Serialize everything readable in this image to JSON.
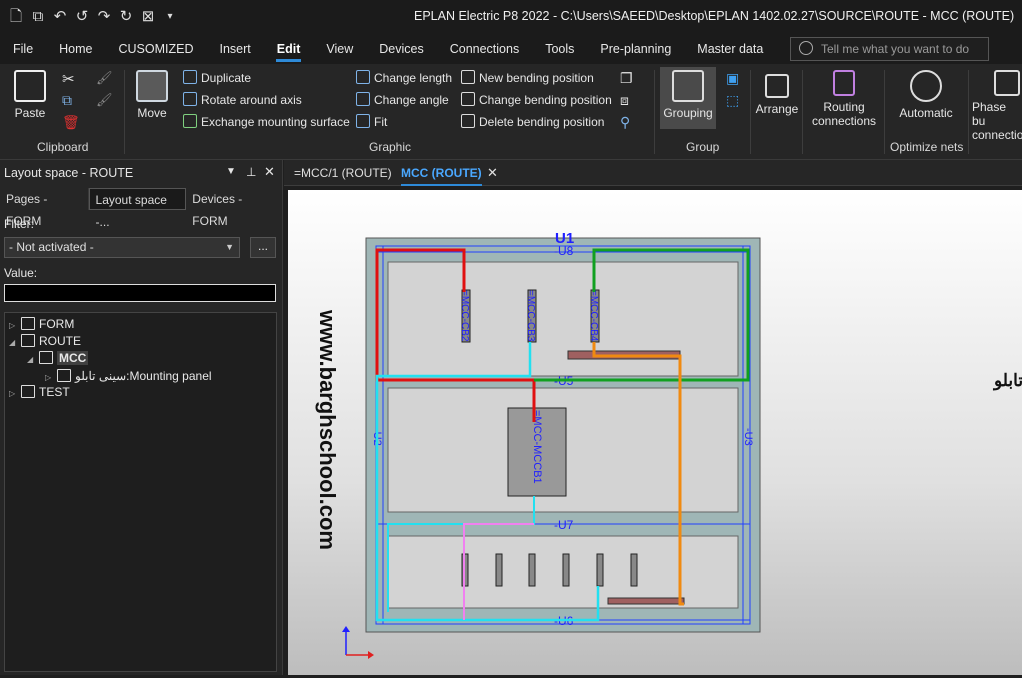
{
  "window": {
    "title": "EPLAN Electric P8 2022 - C:\\Users\\SAEED\\Desktop\\EPLAN 1402.02.27\\SOURCE\\ROUTE - MCC (ROUTE)"
  },
  "menu": {
    "items": [
      "File",
      "Home",
      "CUSOMIZED",
      "Insert",
      "Edit",
      "View",
      "Devices",
      "Connections",
      "Tools",
      "Pre-planning",
      "Master data"
    ],
    "active": "Edit",
    "tell_placeholder": "Tell me what you want to do"
  },
  "ribbon": {
    "clipboard": {
      "paste": "Paste",
      "group": "Clipboard"
    },
    "move": "Move",
    "graphic": {
      "duplicate": "Duplicate",
      "rotate": "Rotate around axis",
      "exchange": "Exchange mounting surface",
      "change_length": "Change length",
      "change_angle": "Change angle",
      "fit": "Fit",
      "new_bending": "New bending position",
      "change_bending": "Change bending position",
      "delete_bending": "Delete bending position",
      "group": "Graphic"
    },
    "grouping": {
      "label": "Grouping",
      "group": "Group"
    },
    "arrange": "Arrange",
    "routing": {
      "line1": "Routing",
      "line2": "connections"
    },
    "automatic": "Automatic",
    "optimize_group": "Optimize nets",
    "phase": {
      "line1": "Phase bu",
      "line2": "connectio"
    }
  },
  "panel": {
    "title": "Layout space - ROUTE",
    "tabs": [
      "Pages - FORM",
      "Layout space -...",
      "Devices - FORM"
    ],
    "filter_label": "Filter:",
    "filter_value": "- Not activated -",
    "dots": "...",
    "value_label": "Value:",
    "tree": {
      "form": "FORM",
      "route": "ROUTE",
      "mcc": "MCC",
      "mounting": "سینی تابلو:Mounting panel",
      "test": "TEST"
    }
  },
  "doc_tabs": [
    "=MCC/1 (ROUTE)",
    "MCC (ROUTE)"
  ],
  "drawing": {
    "u1": "U1",
    "u8": "-U8",
    "u5": "-U5",
    "u7": "-U7",
    "u6": "-U6",
    "u2": "-U2",
    "u3": "-U3",
    "mcc2": "=MCC-CB2",
    "mcc3": "=MCC-CB3",
    "mcc4": "=MCC-CB4",
    "mccb1": "=MCC-MCCB1",
    "watermark": "www.barghschool.com",
    "persian_title": "سیم کشی تجهیزات تابلو"
  },
  "colors": {
    "accent": "#2e8ad8",
    "wire_red": "#e01010",
    "wire_green": "#10a020",
    "wire_cyan": "#22e0f0",
    "wire_orange": "#f08a10",
    "wire_pink": "#f080f0",
    "panel_fill": "#d3d3d3",
    "rail": "#9fb6b6"
  }
}
